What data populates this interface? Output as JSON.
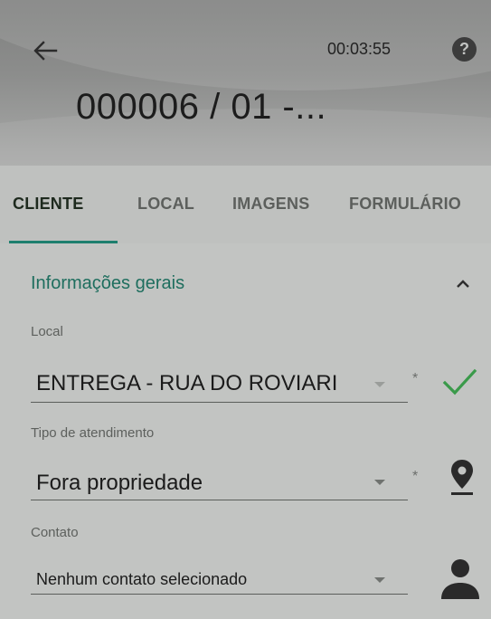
{
  "header": {
    "timer": "00:03:55",
    "title": "000006 / 01 -...",
    "help_label": "?"
  },
  "tabs": [
    {
      "label": "CLIENTE",
      "active": true
    },
    {
      "label": "LOCAL",
      "active": false
    },
    {
      "label": "IMAGENS",
      "active": false
    },
    {
      "label": "FORMULÁRIO",
      "active": false
    }
  ],
  "section": {
    "title": "Informações gerais"
  },
  "fields": {
    "local": {
      "label": "Local",
      "value": "ENTREGA - RUA DO ROVIARI",
      "required": "*"
    },
    "tipo": {
      "label": "Tipo de atendimento",
      "value": "Fora propriedade",
      "required": "*"
    },
    "contato": {
      "label": "Contato",
      "value": "Nenhum contato selecionado"
    }
  },
  "colors": {
    "accent": "#1e7f6e",
    "check": "#3a9a4a"
  },
  "icons": {
    "back": "back-arrow-icon",
    "help": "help-icon",
    "collapse": "chevron-up-icon",
    "local_status": "check-icon",
    "tipo_status": "map-pin-icon",
    "contato_status": "person-icon"
  }
}
